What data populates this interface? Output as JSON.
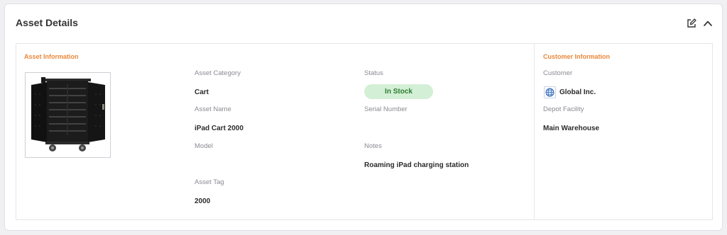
{
  "card": {
    "title": "Asset Details"
  },
  "asset_info": {
    "section_title": "Asset Information",
    "fields": {
      "category_label": "Asset Category",
      "category_value": "Cart",
      "status_label": "Status",
      "status_value": "In Stock",
      "name_label": "Asset Name",
      "name_value": "iPad Cart 2000",
      "serial_label": "Serial Number",
      "serial_value": "",
      "model_label": "Model",
      "model_value": "",
      "notes_label": "Notes",
      "notes_value": "Roaming iPad charging station",
      "tag_label": "Asset Tag",
      "tag_value": "2000"
    }
  },
  "customer_info": {
    "section_title": "Customer Information",
    "customer_label": "Customer",
    "customer_value": "Global Inc.",
    "depot_label": "Depot Facility",
    "depot_value": "Main Warehouse"
  },
  "icons": {
    "edit": "edit-icon",
    "collapse": "chevron-up-icon",
    "customer_logo": "globe-logo-icon",
    "asset_image": "charging-cart-image"
  },
  "colors": {
    "accent": "#e8873a",
    "status_bg": "#d3efd5",
    "status_text": "#2e7d32"
  }
}
